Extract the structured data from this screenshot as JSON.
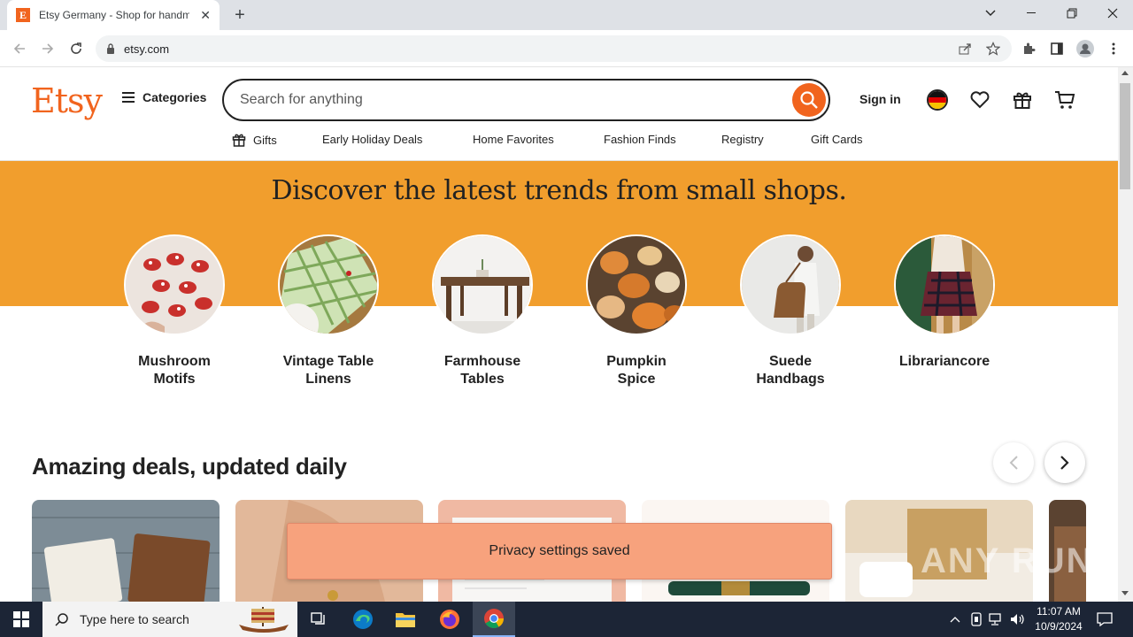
{
  "browser": {
    "tab_title": "Etsy Germany - Shop for handmade",
    "favicon_letter": "E",
    "url": "etsy.com"
  },
  "header": {
    "logo": "Etsy",
    "categories_label": "Categories",
    "search_placeholder": "Search for anything",
    "signin_label": "Sign in"
  },
  "subnav": {
    "items": [
      "Gifts",
      "Early Holiday Deals",
      "Home Favorites",
      "Fashion Finds",
      "Registry",
      "Gift Cards"
    ]
  },
  "hero": {
    "title": "Discover the latest trends from small shops.",
    "trends": [
      {
        "line1": "Mushroom",
        "line2": "Motifs"
      },
      {
        "line1": "Vintage Table",
        "line2": "Linens"
      },
      {
        "line1": "Farmhouse",
        "line2": "Tables"
      },
      {
        "line1": "Pumpkin",
        "line2": "Spice"
      },
      {
        "line1": "Suede",
        "line2": "Handbags"
      },
      {
        "line1": "Librariancore",
        "line2": ""
      }
    ]
  },
  "deals": {
    "title": "Amazing deals, updated daily"
  },
  "toast": {
    "message": "Privacy settings saved"
  },
  "watermark": "ANY RUN",
  "taskbar": {
    "search_placeholder": "Type here to search",
    "time": "11:07 AM",
    "date": "10/9/2024"
  },
  "colors": {
    "brand_orange": "#f1641e",
    "hero_band": "#f19e2d",
    "toast_bg": "#f7a27d"
  }
}
